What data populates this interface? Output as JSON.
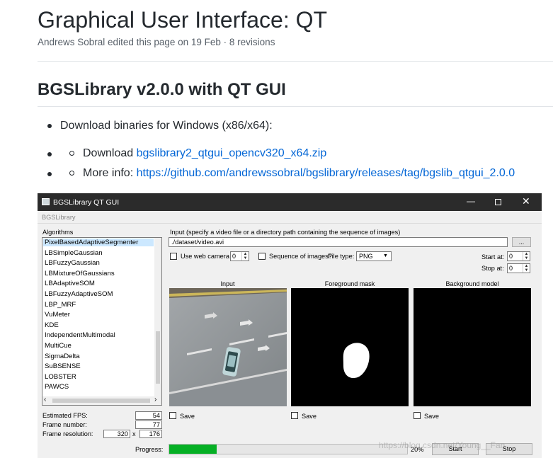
{
  "page": {
    "title": "Graphical User Interface: QT",
    "meta": "Andrews Sobral edited this page on 19 Feb · 8 revisions",
    "section_title": "BGSLibrary v2.0.0 with QT GUI",
    "bullet1": "Download binaries for Windows (x86/x64):",
    "sub1_prefix": "Download ",
    "sub1_link": "bgslibrary2_qtgui_opencv320_x64.zip",
    "sub2_prefix": "More info: ",
    "sub2_link": "https://github.com/andrewssobral/bgslibrary/releases/tag/bgslib_qtgui_2.0.0"
  },
  "app": {
    "window_title": "BGSLibrary QT GUI",
    "menu_label": "BGSLibrary",
    "algorithms_label": "Algorithms",
    "algorithms": [
      "PixelBasedAdaptiveSegmenter",
      "LBSimpleGaussian",
      "LBFuzzyGaussian",
      "LBMixtureOfGaussians",
      "LBAdaptiveSOM",
      "LBFuzzyAdaptiveSOM",
      "LBP_MRF",
      "VuMeter",
      "KDE",
      "IndependentMultimodal",
      "MultiCue",
      "SigmaDelta",
      "SuBSENSE",
      "LOBSTER",
      "PAWCS"
    ],
    "selected_algorithm_index": 0,
    "input_label": "Input (specify a video file or a directory path containing the sequence of images)",
    "input_path": "./dataset/video.avi",
    "browse_label": "...",
    "use_webcam_label": "Use web camera",
    "webcam_index": "0",
    "sequence_label": "Sequence of images?",
    "file_type_label": "File type:",
    "file_type_value": "PNG",
    "start_at_label": "Start at:",
    "start_at_value": "0",
    "stop_at_label": "Stop at:",
    "stop_at_value": "0",
    "panel_input": "Input",
    "panel_foreground": "Foreground mask",
    "panel_background": "Background model",
    "save_label": "Save",
    "fps_label": "Estimated FPS:",
    "fps_value": "54",
    "frame_number_label": "Frame number:",
    "frame_number_value": "77",
    "frame_resolution_label": "Frame resolution:",
    "frame_width": "320",
    "frame_x": "x",
    "frame_height": "176",
    "progress_label": "Progress:",
    "progress_value": 0.2,
    "progress_text": "20%",
    "start_label": "Start",
    "stop_label": "Stop",
    "watermark": "https://blog.csdn.net/Young__Fan"
  },
  "colors": {
    "link": "#0366d6",
    "titlebar": "#2b2b2b",
    "progress": "#06b025",
    "selection": "#cce8ff"
  },
  "icons": {
    "bullet": "disc",
    "sub_bullet": "circle",
    "minimize": "minimize-icon",
    "maximize": "maximize-icon",
    "close": "close-icon",
    "app": "app-icon"
  }
}
